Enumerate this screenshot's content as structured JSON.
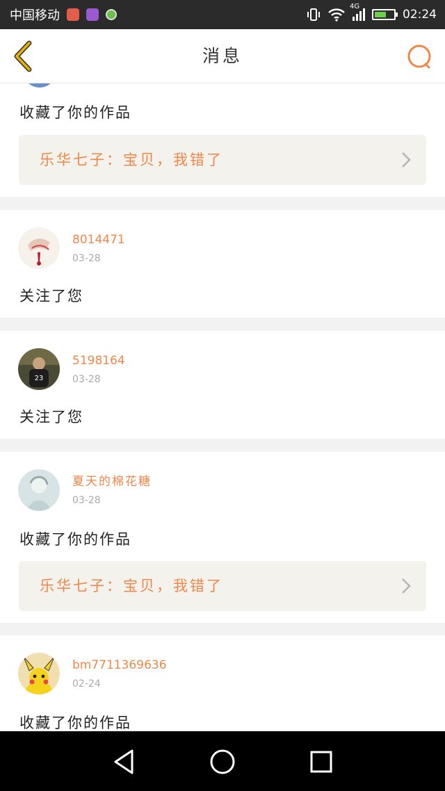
{
  "status_bar": {
    "carrier": "中国移动",
    "network": "4G",
    "time": "02:24",
    "battery_level": 0.6
  },
  "header": {
    "title": "消息",
    "back_icon": "back-chevron-icon",
    "search_icon": "search-icon"
  },
  "messages": [
    {
      "action": "收藏了你的作品",
      "work": "乐华七子：宝贝，我错了"
    },
    {
      "username": "8014471",
      "date": "03-28",
      "action": "关注了您"
    },
    {
      "username": "5198164",
      "date": "03-28",
      "action": "关注了您"
    },
    {
      "username": "夏天的棉花糖",
      "date": "03-28",
      "action": "收藏了你的作品",
      "work": "乐华七子：宝贝，我错了"
    },
    {
      "username": "bm7711369636",
      "date": "02-24",
      "action": "收藏了你的作品"
    }
  ],
  "colors": {
    "accent": "#f0874a",
    "back_icon": "#e8b400",
    "work_bg": "#f3f2ec"
  },
  "nav_bar": {
    "icons": [
      "back-triangle-icon",
      "home-circle-icon",
      "recents-square-icon"
    ]
  }
}
